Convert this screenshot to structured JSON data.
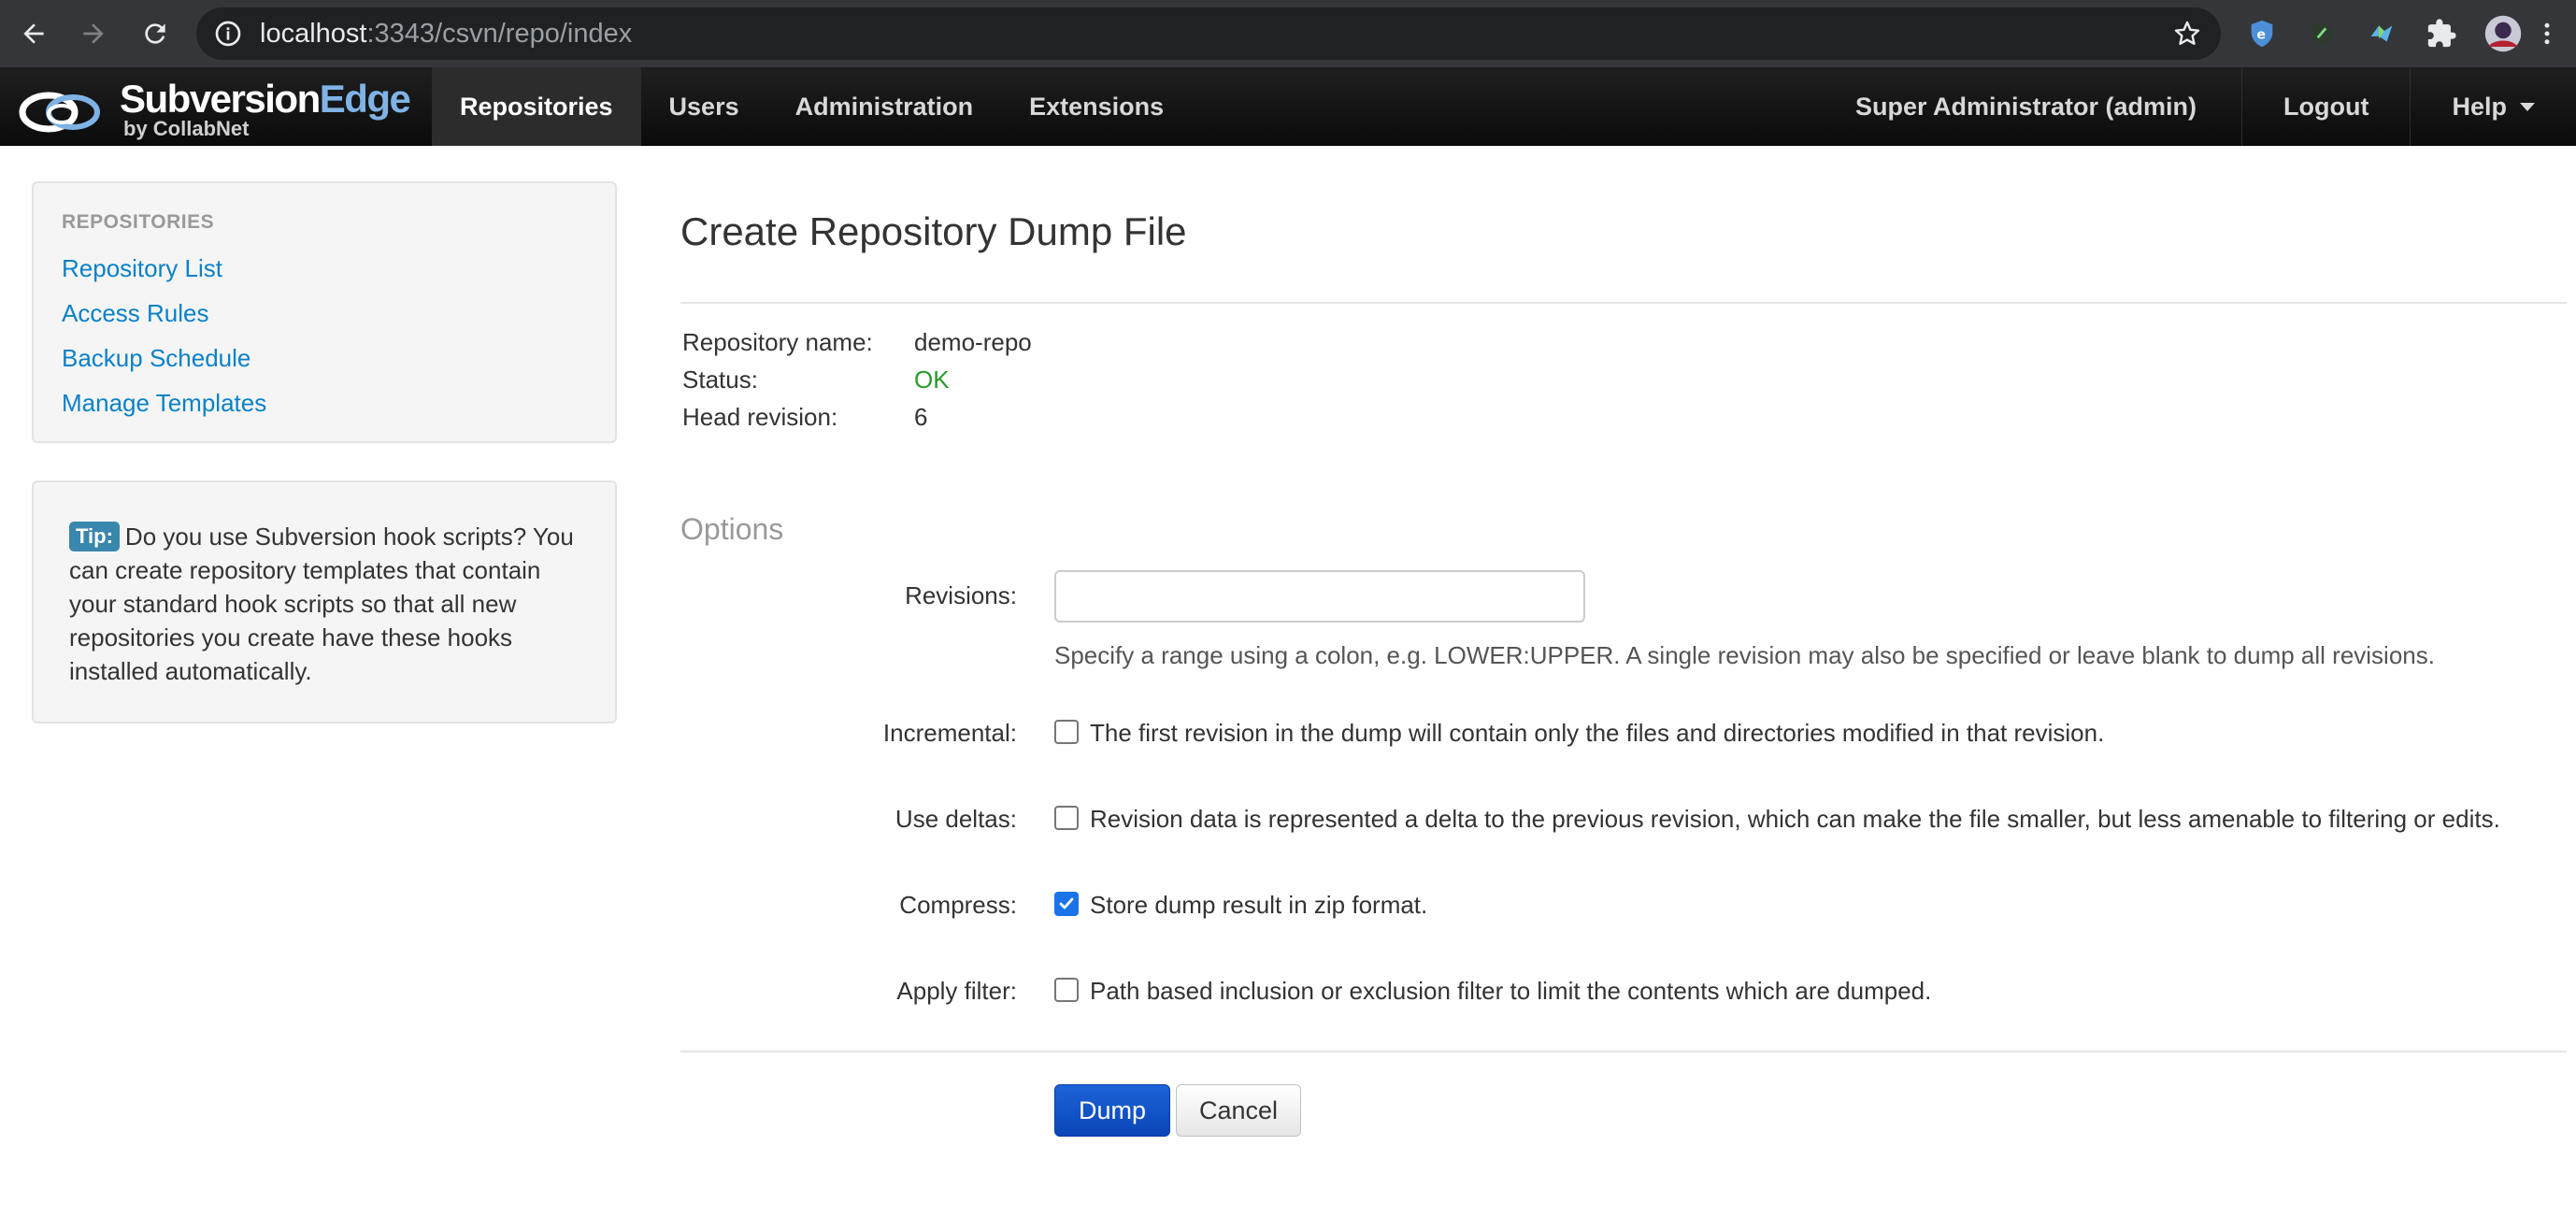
{
  "browser": {
    "url_host": "localhost",
    "url_rest": ":3343/csvn/repo/index"
  },
  "brand": {
    "name_part1": "Subversion",
    "name_part2": "Edge",
    "byline": "by CollabNet"
  },
  "nav": {
    "items": [
      {
        "label": "Repositories",
        "active": true
      },
      {
        "label": "Users",
        "active": false
      },
      {
        "label": "Administration",
        "active": false
      },
      {
        "label": "Extensions",
        "active": false
      }
    ],
    "user": "Super Administrator (admin)",
    "logout": "Logout",
    "help": "Help"
  },
  "sidebar": {
    "header": "REPOSITORIES",
    "links": [
      "Repository List",
      "Access Rules",
      "Backup Schedule",
      "Manage Templates"
    ],
    "tip_badge": "Tip:",
    "tip_text": "Do you use Subversion hook scripts? You can create repository templates that contain your standard hook scripts so that all new repositories you create have these hooks installed automatically."
  },
  "main": {
    "title": "Create Repository Dump File",
    "info": [
      {
        "label": "Repository name:",
        "value": "demo-repo"
      },
      {
        "label": "Status:",
        "value": "OK"
      },
      {
        "label": "Head revision:",
        "value": "6"
      }
    ],
    "options_legend": "Options",
    "revisions": {
      "label": "Revisions:",
      "value": "",
      "help": "Specify a range using a colon, e.g. LOWER:UPPER. A single revision may also be specified or leave blank to dump all revisions."
    },
    "incremental": {
      "label": "Incremental:",
      "text": "The first revision in the dump will contain only the files and directories modified in that revision.",
      "checked": false
    },
    "deltas": {
      "label": "Use deltas:",
      "text": "Revision data is represented a delta to the previous revision, which can make the file smaller, but less amenable to filtering or edits.",
      "checked": false
    },
    "compress": {
      "label": "Compress:",
      "text": "Store dump result in zip format.",
      "checked": true
    },
    "filter": {
      "label": "Apply filter:",
      "text": "Path based inclusion or exclusion filter to limit the contents which are dumped.",
      "checked": false
    },
    "dump_button": "Dump",
    "cancel_button": "Cancel"
  },
  "colors": {
    "link": "#0a81c8",
    "status_ok": "#2a9a2a",
    "primary_button": "#1c64d8",
    "tip_badge": "#3a87ad",
    "header_bg": "#141414"
  }
}
